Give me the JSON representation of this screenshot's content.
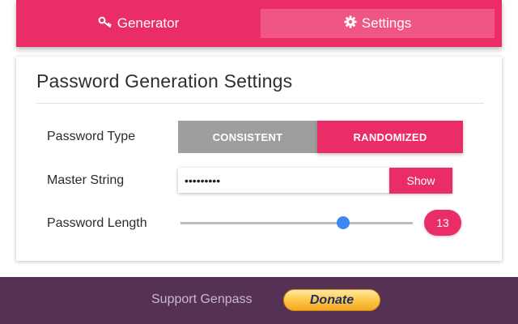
{
  "tabs": {
    "generator": {
      "label": "Generator",
      "icon": "key-icon"
    },
    "settings": {
      "label": "Settings",
      "icon": "gear-icon",
      "active": true
    }
  },
  "settings_card": {
    "title": "Password Generation Settings",
    "password_type": {
      "label": "Password Type",
      "options": [
        "CONSISTENT",
        "RANDOMIZED"
      ],
      "selected": "RANDOMIZED"
    },
    "master_string": {
      "label": "Master String",
      "value": "•••••••••",
      "show_label": "Show"
    },
    "password_length": {
      "label": "Password Length",
      "value": "13",
      "slider_fraction": 0.7
    }
  },
  "footer": {
    "support_text": "Support Genpass",
    "donate_label": "Donate"
  },
  "colors": {
    "accent": "#ea2c67",
    "accent_light": "#ef5686",
    "inactive": "#9e9e9e",
    "slider_thumb": "#3d87f5",
    "footer_bg": "#553255"
  }
}
